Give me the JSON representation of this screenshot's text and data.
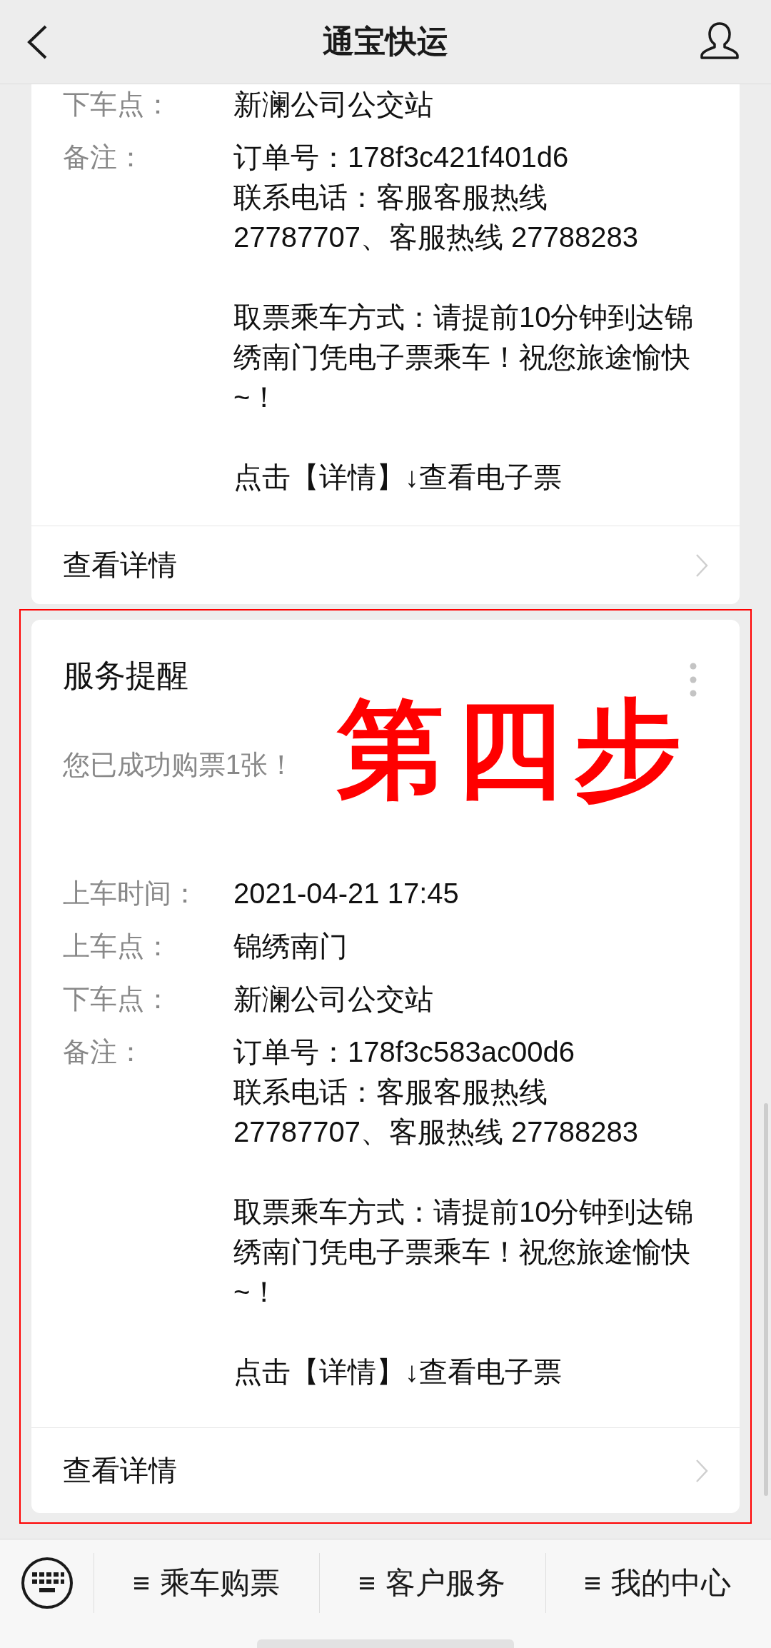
{
  "header": {
    "title": "通宝快运"
  },
  "cards": [
    {
      "fields": [
        {
          "label": "下车点：",
          "paragraphs": [
            [
              "新澜公司公交站"
            ]
          ]
        },
        {
          "label": "备注：",
          "paragraphs": [
            [
              "订单号：178f3c421f401d6",
              "联系电话：客服客服热线",
              "27787707、客服热线 27788283"
            ],
            [
              "取票乘车方式：请提前10分钟到达锦",
              "绣南门凭电子票乘车！祝您旅途愉快",
              "~！"
            ],
            [
              "点击【详情】↓查看电子票"
            ]
          ]
        }
      ],
      "action": "查看详情",
      "highlighted": false
    },
    {
      "title": "服务提醒",
      "subtitle": "您已成功购票1张！",
      "menu": true,
      "annotation": "第四步",
      "fields": [
        {
          "label": "上车时间：",
          "paragraphs": [
            [
              "2021-04-21 17:45"
            ]
          ]
        },
        {
          "label": "上车点：",
          "paragraphs": [
            [
              "锦绣南门"
            ]
          ]
        },
        {
          "label": "下车点：",
          "paragraphs": [
            [
              "新澜公司公交站"
            ]
          ]
        },
        {
          "label": "备注：",
          "paragraphs": [
            [
              "订单号：178f3c583ac00d6",
              "联系电话：客服客服热线",
              "27787707、客服热线 27788283"
            ],
            [
              "取票乘车方式：请提前10分钟到达锦",
              "绣南门凭电子票乘车！祝您旅途愉快",
              "~！"
            ],
            [
              "点击【详情】↓查看电子票"
            ]
          ]
        }
      ],
      "action": "查看详情",
      "highlighted": true
    }
  ],
  "menu_bar": {
    "items": [
      "乘车购票",
      "客户服务",
      "我的中心"
    ]
  }
}
